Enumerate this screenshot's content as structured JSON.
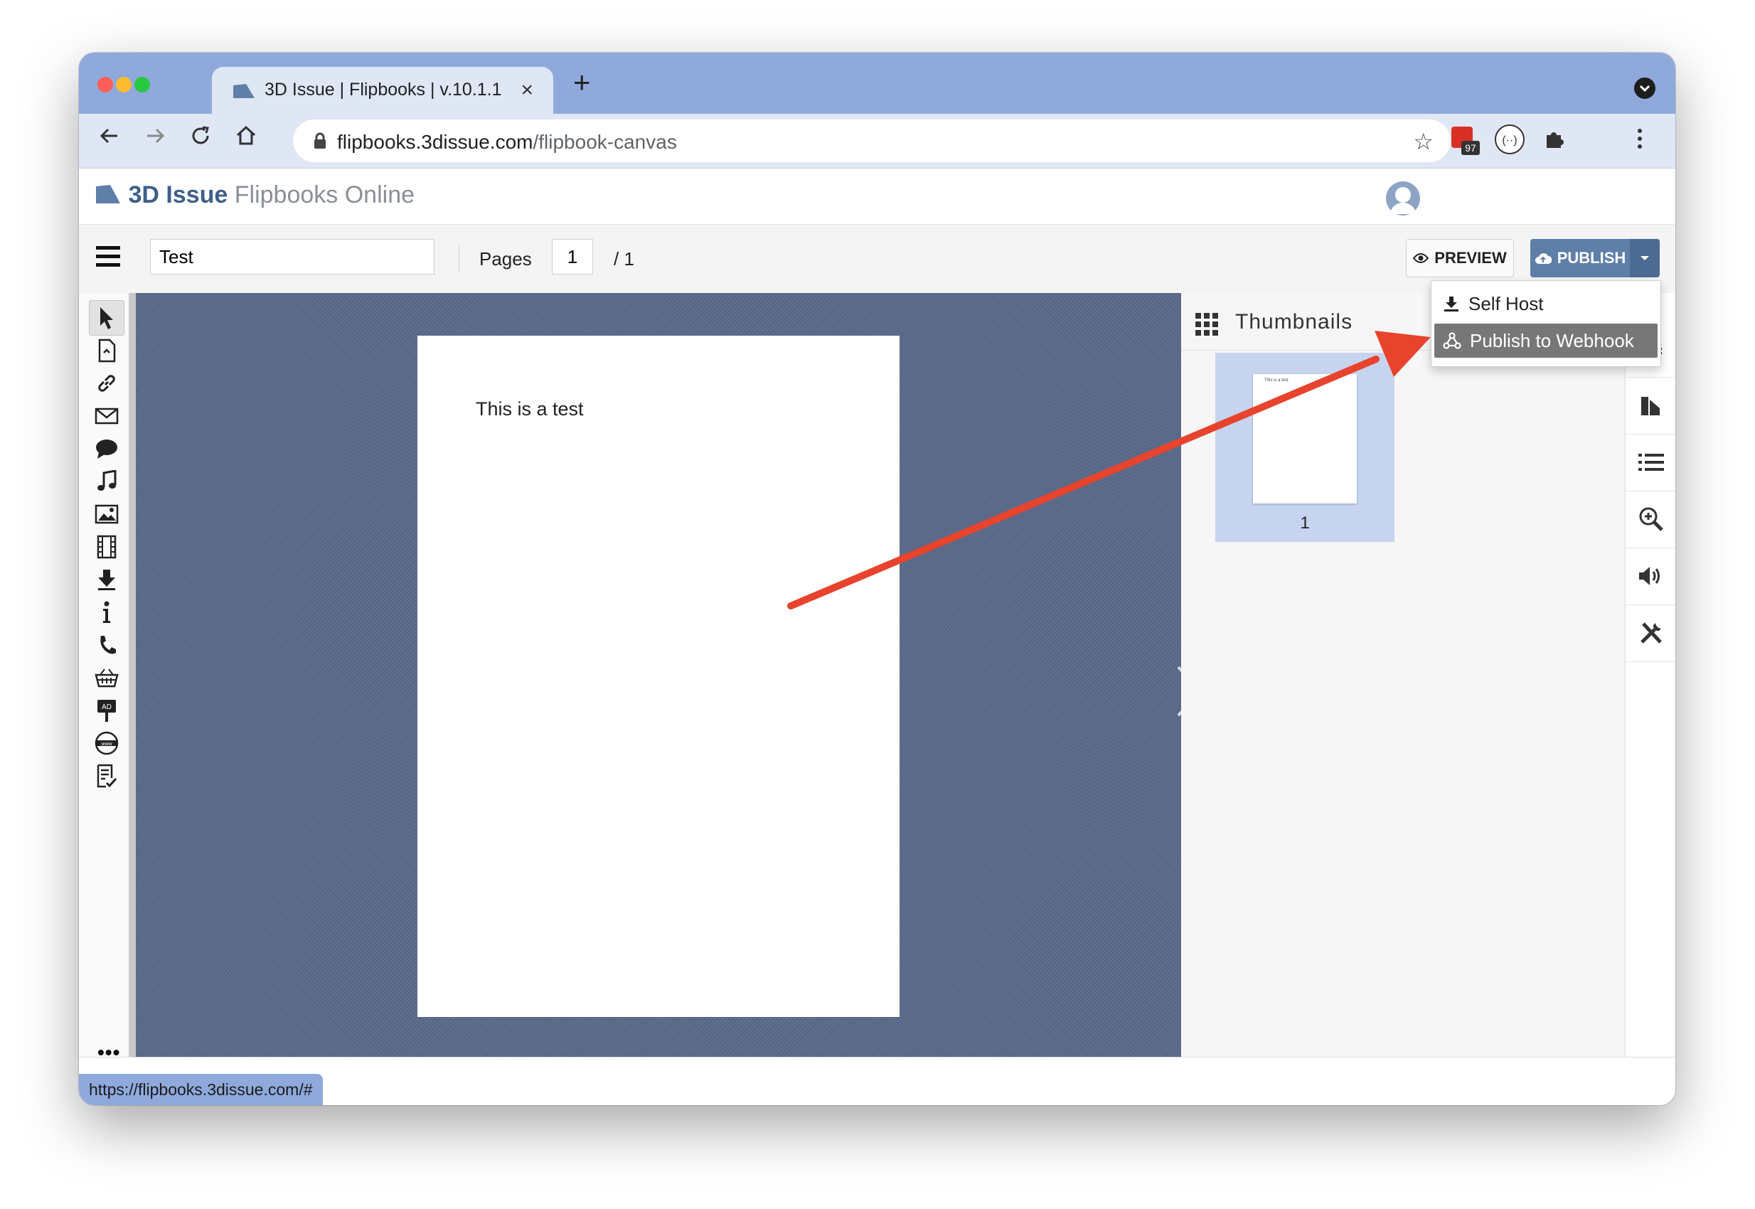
{
  "browser": {
    "tab_title": "3D Issue | Flipbooks | v.10.1.1",
    "url_host": "flipbooks.3dissue.com",
    "url_path": "/flipbook-canvas",
    "extension_badge": "97"
  },
  "app": {
    "brand": "3D Issue",
    "product": "Flipbooks Online"
  },
  "toolbar": {
    "title_value": "Test",
    "pages_label": "Pages",
    "current_page": "1",
    "total_pages": "/ 1",
    "preview_label": "PREVIEW",
    "publish_label": "PUBLISH"
  },
  "publish_menu": {
    "items": [
      {
        "label": "Self Host",
        "icon": "download-icon"
      },
      {
        "label": "Publish to Webhook",
        "icon": "webhook-icon"
      }
    ]
  },
  "canvas": {
    "page_text": "This is a test"
  },
  "thumbnails": {
    "title": "Thumbnails",
    "items": [
      {
        "number": "1",
        "preview_text": "This is a test"
      }
    ]
  },
  "left_tools": [
    "select-arrow-icon",
    "page-icon",
    "link-icon",
    "email-icon",
    "comment-icon",
    "music-icon",
    "image-icon",
    "video-icon",
    "download-icon",
    "info-icon",
    "phone-icon",
    "shopping-basket-icon",
    "ad-sign-icon",
    "web-icon",
    "form-checklist-icon"
  ],
  "right_tools": [
    "layers-icon",
    "style-icon",
    "list-icon",
    "zoom-icon",
    "audio-icon",
    "settings-tools-icon"
  ],
  "status_bar": {
    "url": "https://flipbooks.3dissue.com/#"
  },
  "colors": {
    "titlebar": "#8fa9dc",
    "publish": "#5e7fa8",
    "canvas": "#59698a",
    "annotation_arrow": "#e8432d"
  }
}
